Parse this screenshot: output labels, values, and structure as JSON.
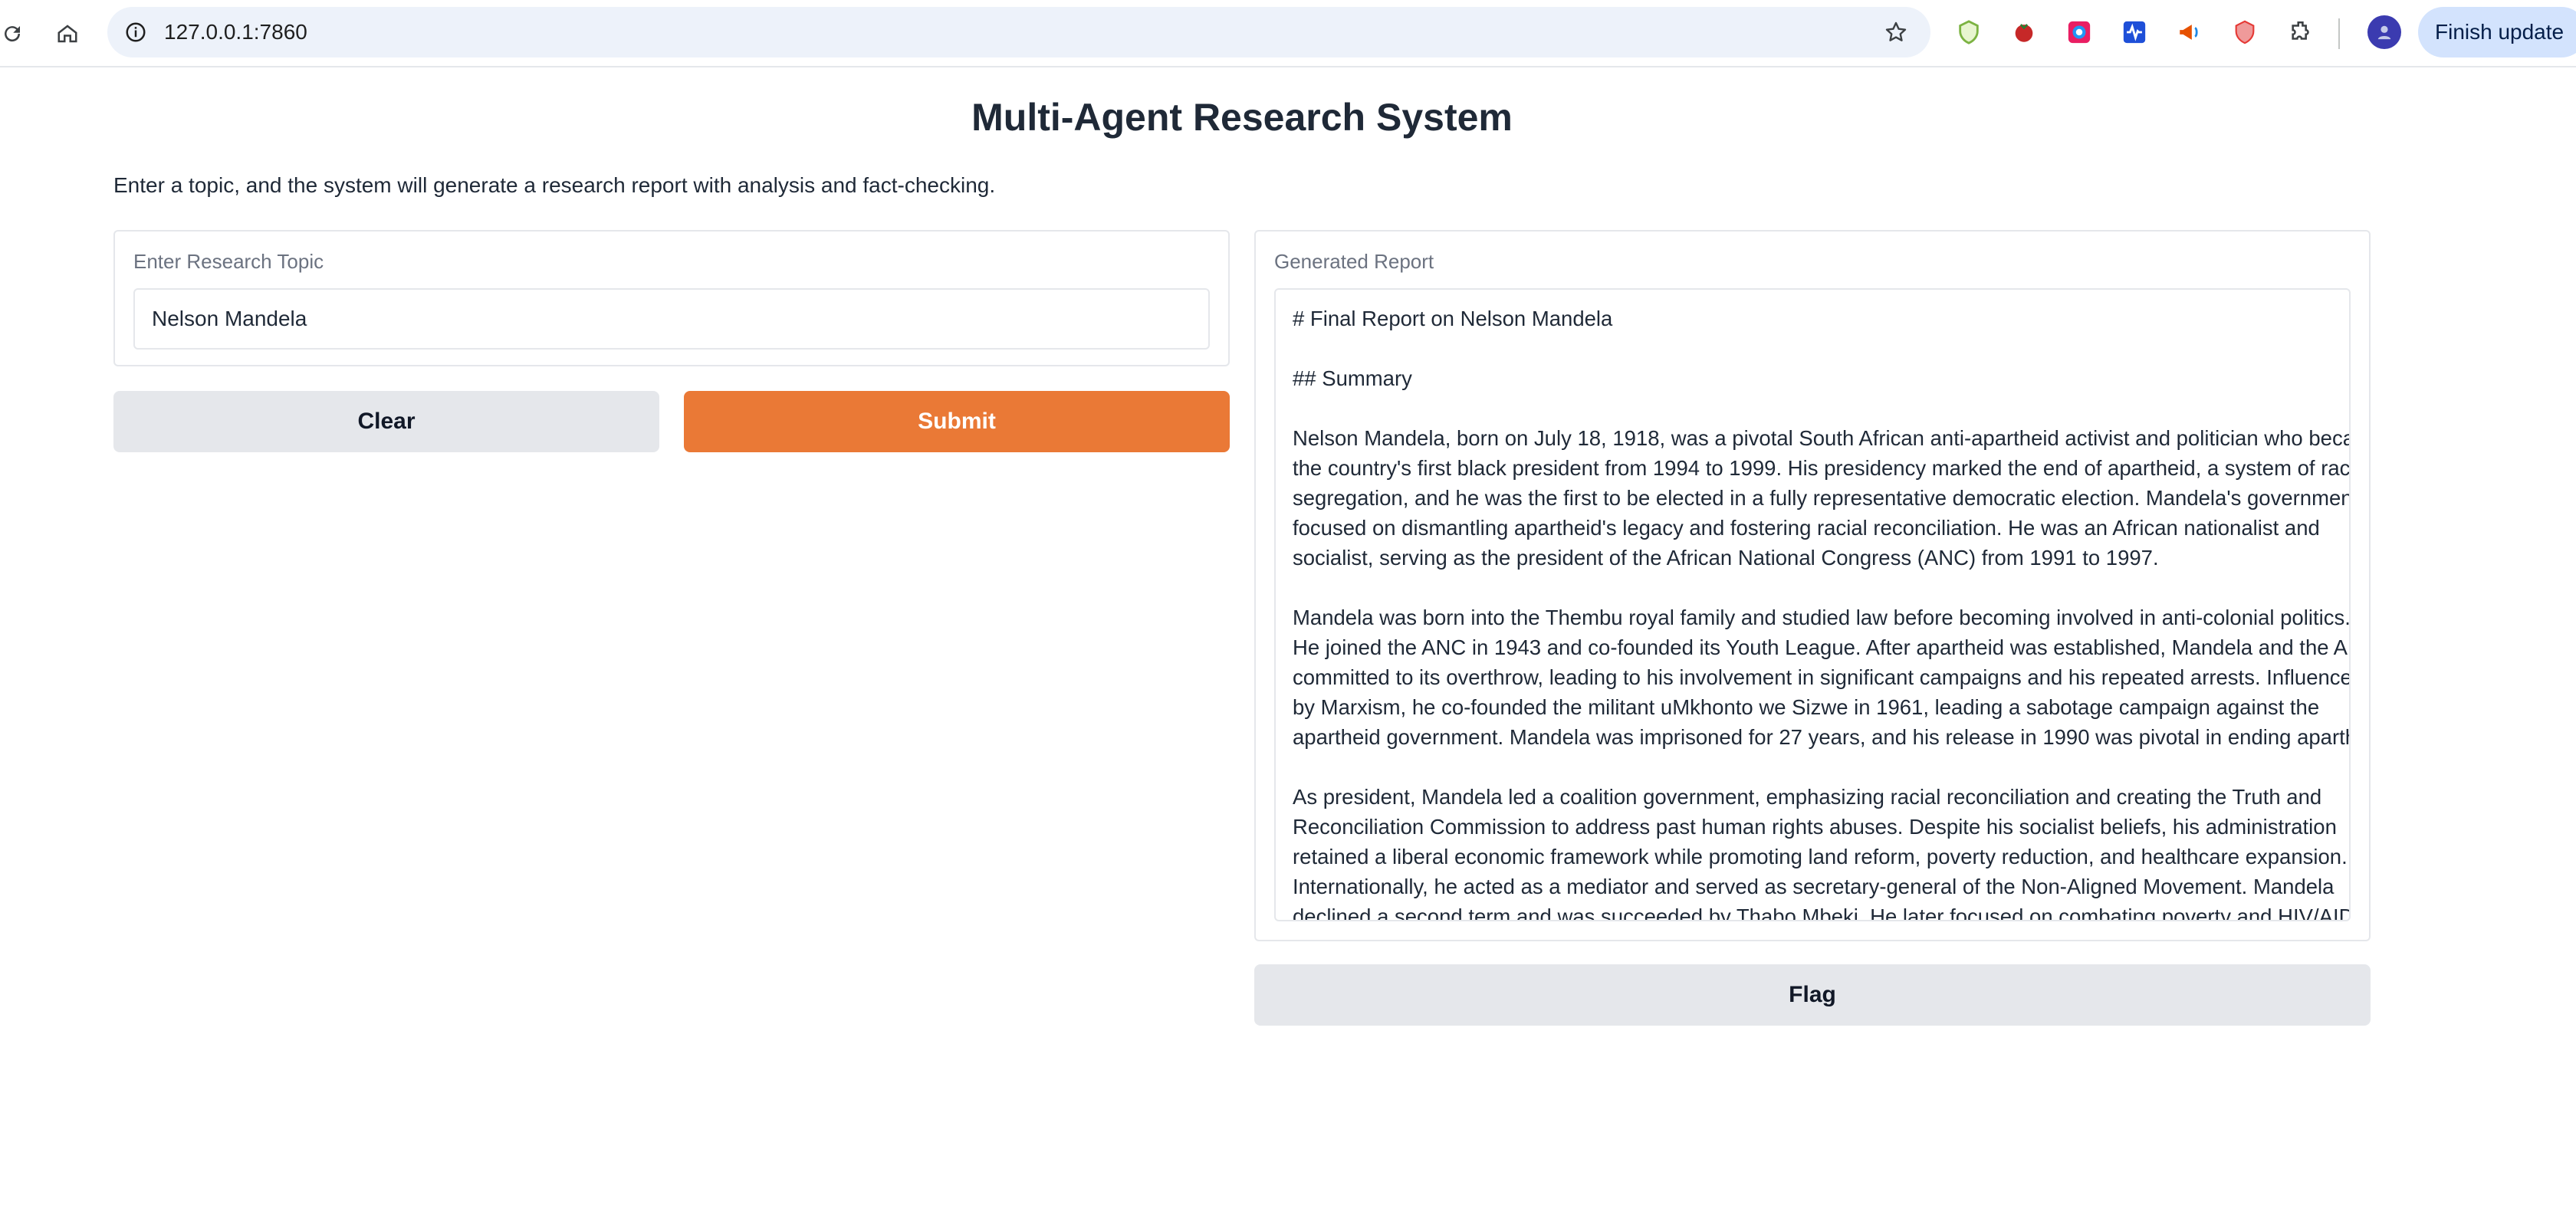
{
  "browser": {
    "url": "127.0.0.1:7860",
    "update_label": "Finish update",
    "icons": [
      "reload-icon",
      "home-icon",
      "site-info-icon",
      "bookmark-star-icon",
      "extensions-puzzle-icon"
    ]
  },
  "page": {
    "title": "Multi-Agent Research System",
    "description": "Enter a topic, and the system will generate a research report with analysis and fact-checking."
  },
  "input_panel": {
    "label": "Enter Research Topic",
    "value": "Nelson Mandela"
  },
  "buttons": {
    "clear": "Clear",
    "submit": "Submit",
    "flag": "Flag"
  },
  "output_panel": {
    "label": "Generated Report",
    "heading": "# Final Report on Nelson Mandela",
    "subheading": "## Summary",
    "paragraph1": [
      "Nelson Mandela, born on July 18, 1918, was a pivotal South African anti-apartheid activist and politician who became",
      "the country's first black president from 1994 to 1999. His presidency marked the end of apartheid, a system of racial",
      "segregation, and he was the first to be elected in a fully representative democratic election. Mandela's government",
      "focused on dismantling apartheid's legacy and fostering racial reconciliation. He was an African nationalist and",
      "socialist, serving as the president of the African National Congress (ANC) from 1991 to 1997."
    ],
    "paragraph2": [
      "Mandela was born into the Thembu royal family and studied law before becoming involved in anti-colonial politics.",
      "He joined the ANC in 1943 and co-founded its Youth League. After apartheid was established, Mandela and the ANC",
      "committed to its overthrow, leading to his involvement in significant campaigns and his repeated arrests. Influenced",
      "by Marxism, he co-founded the militant uMkhonto we Sizwe in 1961, leading a sabotage campaign against the",
      "apartheid government. Mandela was imprisoned for 27 years, and his release in 1990 was pivotal in ending apartheid."
    ],
    "paragraph3": [
      "As president, Mandela led a coalition government, emphasizing racial reconciliation and creating the Truth and",
      "Reconciliation Commission to address past human rights abuses. Despite his socialist beliefs, his administration",
      "retained a liberal economic framework while promoting land reform, poverty reduction, and healthcare expansion.",
      "Internationally, he acted as a mediator and served as secretary-general of the Non-Aligned Movement. Mandela",
      "declined a second term and was succeeded by Thabo Mbeki. He later focused on combating poverty and HIV/AIDS"
    ]
  },
  "colors": {
    "primary": "#ea7936",
    "secondary": "#e5e7eb",
    "border": "#e5e7eb"
  }
}
